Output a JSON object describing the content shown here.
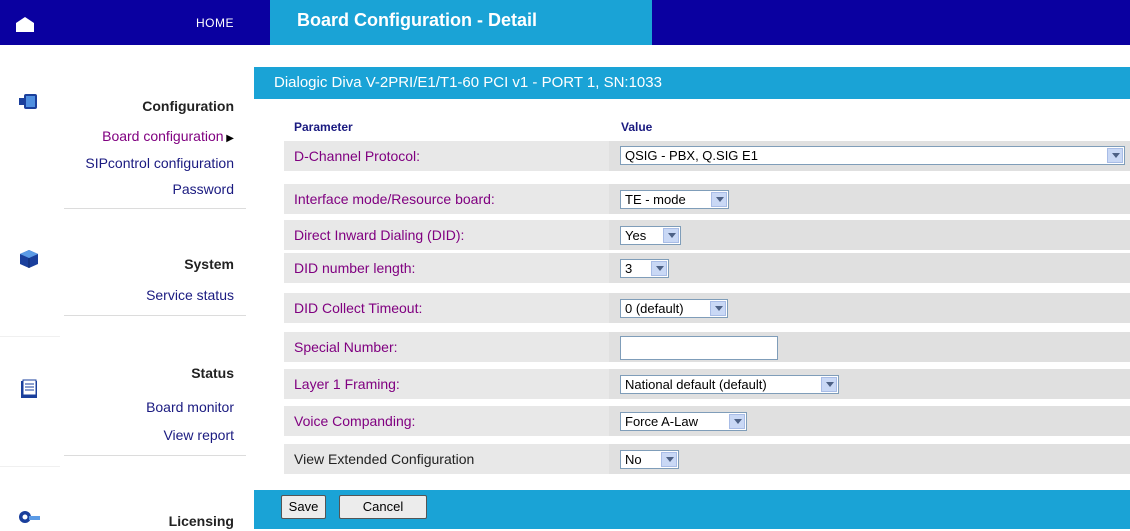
{
  "header": {
    "home_label": "HOME",
    "title": "Board Configuration - Detail"
  },
  "sidebar": {
    "sections": [
      {
        "title": "Configuration",
        "icon": "configuration-icon",
        "items": [
          {
            "label": "Board configuration",
            "active": true
          },
          {
            "label": "SIPcontrol configuration",
            "active": false
          },
          {
            "label": "Password",
            "active": false
          }
        ]
      },
      {
        "title": "System",
        "icon": "system-cube-icon",
        "items": [
          {
            "label": "Service status",
            "active": false
          }
        ]
      },
      {
        "title": "Status",
        "icon": "status-document-icon",
        "items": [
          {
            "label": "Board monitor",
            "active": false
          },
          {
            "label": "View report",
            "active": false
          }
        ]
      },
      {
        "title": "Licensing",
        "icon": "licensing-key-icon",
        "items": []
      }
    ]
  },
  "main": {
    "port_title": "Dialogic Diva V-2PRI/E1/T1-60 PCI v1 - PORT 1, SN:1033",
    "col_parameter": "Parameter",
    "col_value": "Value",
    "rows": [
      {
        "label": "D-Channel Protocol:",
        "value": "QSIG - PBX, Q.SIG E1",
        "type": "select"
      },
      {
        "label": "Interface mode/Resource board:",
        "value": "TE - mode",
        "type": "select"
      },
      {
        "label": "Direct Inward Dialing (DID):",
        "value": "Yes",
        "type": "select"
      },
      {
        "label": "DID number length:",
        "value": "3",
        "type": "select"
      },
      {
        "label": "DID Collect Timeout:",
        "value": "0 (default)",
        "type": "select"
      },
      {
        "label": "Special Number:",
        "value": "",
        "type": "text"
      },
      {
        "label": "Layer 1 Framing:",
        "value": "National default (default)",
        "type": "select"
      },
      {
        "label": "Voice Companding:",
        "value": "Force A-Law",
        "type": "select"
      },
      {
        "label": "View Extended Configuration",
        "value": "No",
        "type": "select"
      }
    ],
    "save_label": "Save",
    "cancel_label": "Cancel"
  },
  "colors": {
    "top_bar": "#0a00a0",
    "accent": "#1aa3d6",
    "label_purple": "#800080",
    "nav_link": "#1a1a80"
  }
}
